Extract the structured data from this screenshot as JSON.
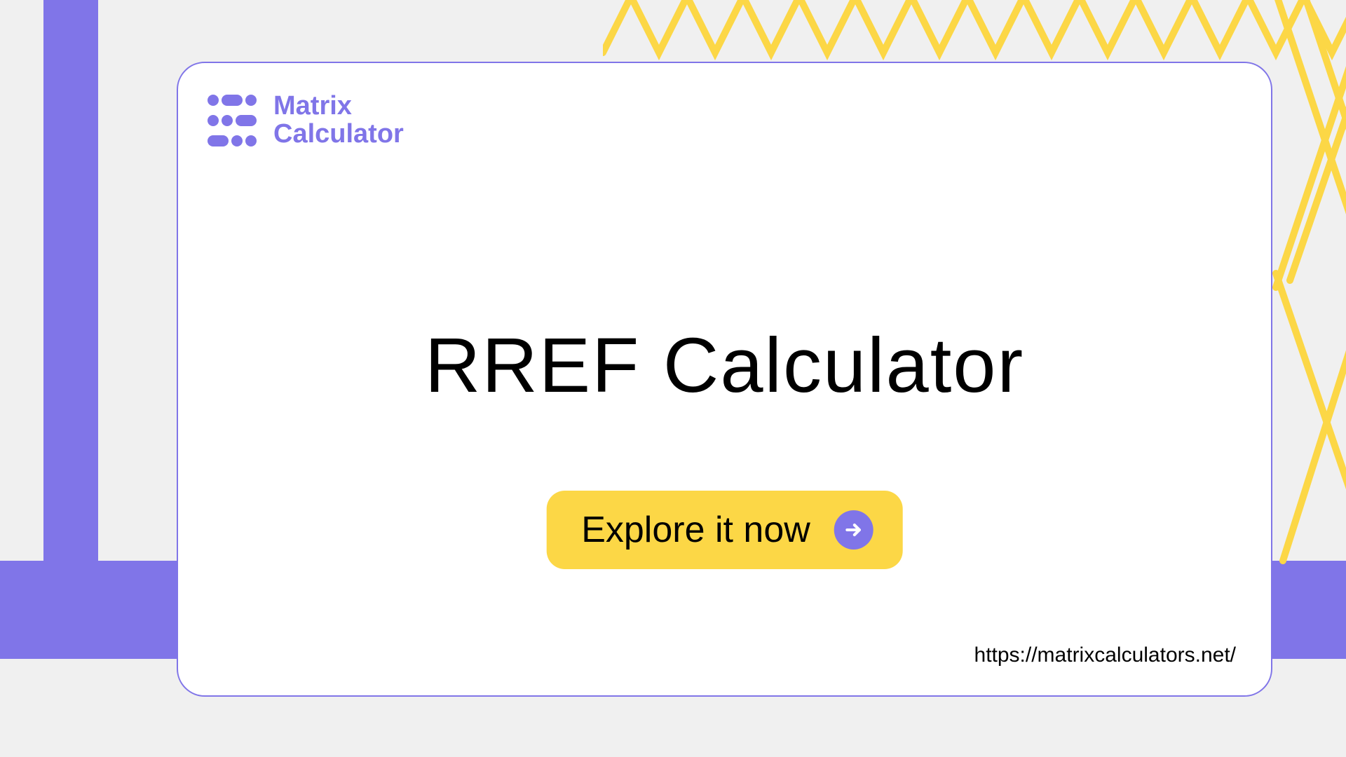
{
  "logo": {
    "line1": "Matrix",
    "line2": "Calculator"
  },
  "title": "RREF Calculator",
  "cta": {
    "label": "Explore it now"
  },
  "url": "https://matrixcalculators.net/",
  "colors": {
    "accent": "#8075e8",
    "highlight": "#fcd746"
  }
}
